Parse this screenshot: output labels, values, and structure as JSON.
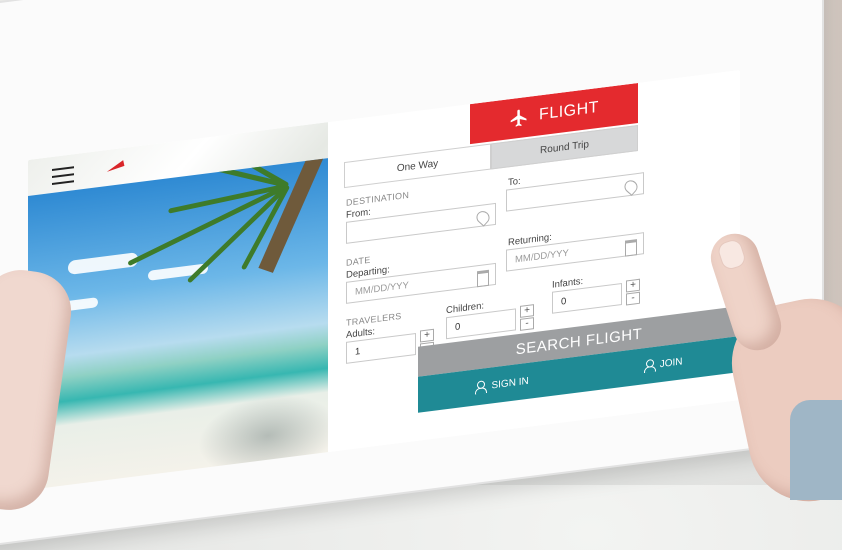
{
  "tabs": {
    "flight_label": "FLIGHT"
  },
  "trip_type": {
    "one_way": "One Way",
    "round_trip": "Round Trip",
    "selected": "Round Trip"
  },
  "destination": {
    "section": "DESTINATION",
    "from_label": "From:",
    "to_label": "To:"
  },
  "dates": {
    "section": "DATE",
    "departing_label": "Departing:",
    "departing_placeholder": "MM/DD/YYY",
    "returning_label": "Returning:",
    "returning_placeholder": "MM/DD/YYY"
  },
  "travelers": {
    "section": "TRAVELERS",
    "adults_label": "Adults:",
    "adults_value": "1",
    "children_label": "Children:",
    "children_value": "0",
    "infants_label": "Infants:",
    "infants_value": "0",
    "plus": "+",
    "minus": "-"
  },
  "actions": {
    "search": "SEARCH FLIGHT",
    "sign_in": "SIGN IN",
    "join": "JOIN"
  },
  "colors": {
    "accent_red": "#e42a2e",
    "teal": "#1f8a95",
    "search_gray": "#9d9fa1"
  },
  "icons": [
    "menu-icon",
    "airplane-icon",
    "map-pin-icon",
    "calendar-icon",
    "user-icon"
  ]
}
